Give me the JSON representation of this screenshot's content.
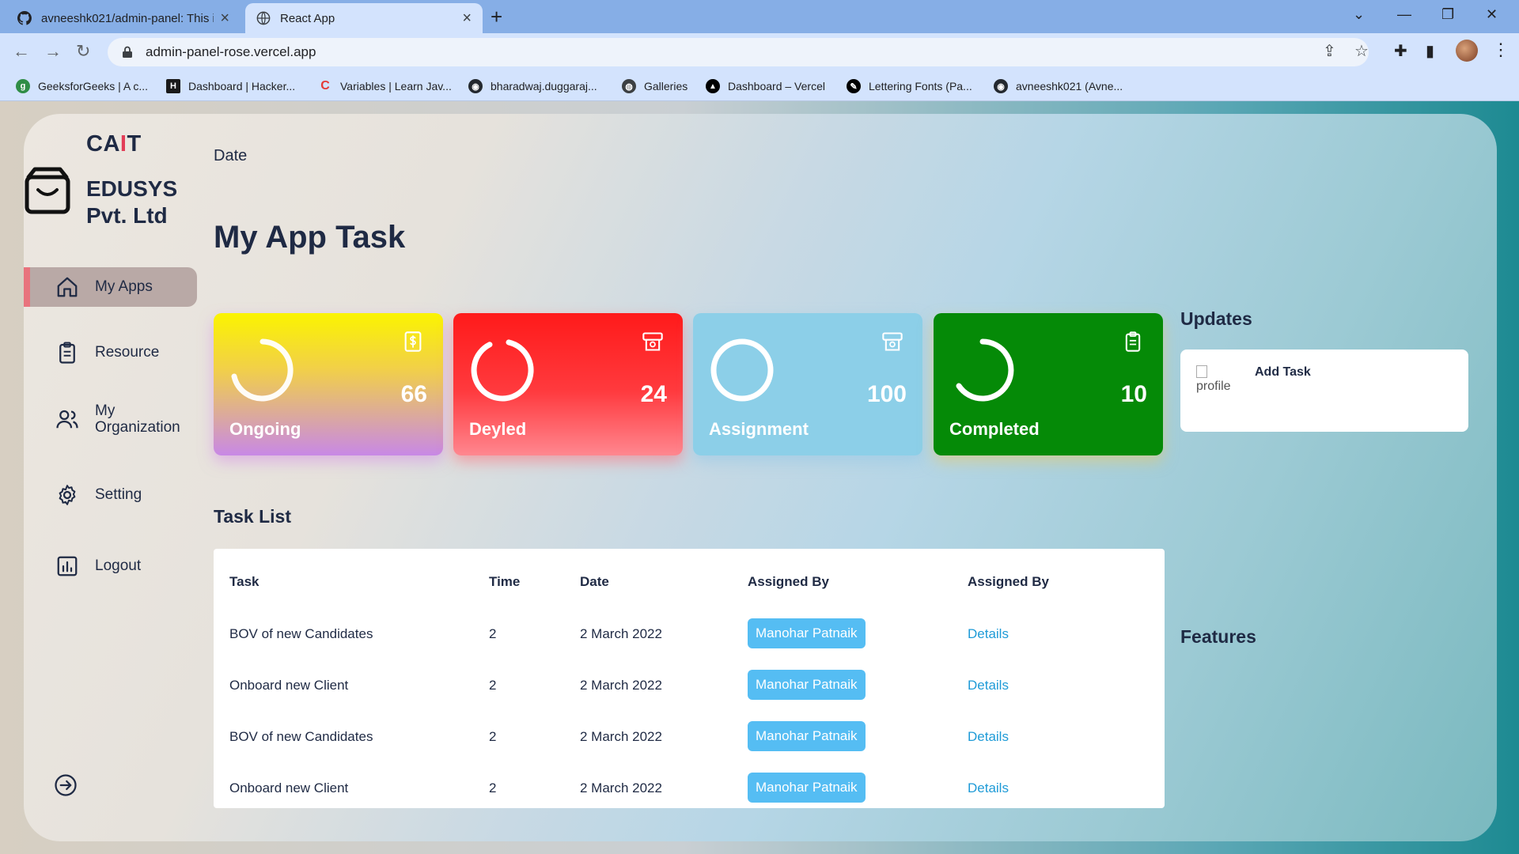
{
  "browser": {
    "tabs": [
      {
        "title": "avneeshk021/admin-panel: This i",
        "icon": "github-icon"
      },
      {
        "title": "React App",
        "icon": "globe-icon"
      }
    ],
    "url": "admin-panel-rose.vercel.app",
    "bookmarks": [
      {
        "label": "GeeksforGeeks | A c...",
        "icon": "gfg-icon",
        "color": "#2f8d46"
      },
      {
        "label": "Dashboard | Hacker...",
        "icon": "hackerrank-icon",
        "color": "#1a1a1a"
      },
      {
        "label": "Variables | Learn Jav...",
        "icon": "codecademy-icon",
        "color": "#e53935"
      },
      {
        "label": "bharadwaj.duggaraj...",
        "icon": "github-icon",
        "color": "#24292f"
      },
      {
        "label": "Galleries",
        "icon": "globe-icon",
        "color": "#3c4043"
      },
      {
        "label": "Dashboard – Vercel",
        "icon": "vercel-icon",
        "color": "#000000"
      },
      {
        "label": "Lettering Fonts (Pa...",
        "icon": "font-site-icon",
        "color": "#000000"
      },
      {
        "label": "avneeshk021 (Avne...",
        "icon": "github-icon",
        "color": "#24292f"
      }
    ]
  },
  "brand": {
    "title_part1": "CA",
    "title_accent": "I",
    "title_part2": "T",
    "name": "EDUSYS Pvt. Ltd"
  },
  "sidebar": {
    "items": [
      {
        "label": "My Apps",
        "icon": "home-icon",
        "active": true
      },
      {
        "label": "Resource",
        "icon": "clipboard-icon"
      },
      {
        "label": "My Organization",
        "icon": "users-icon"
      },
      {
        "label": "Setting",
        "icon": "gear-icon"
      },
      {
        "label": "Logout",
        "icon": "chart-icon"
      }
    ]
  },
  "main": {
    "date_label": "Date",
    "title": "My App Task",
    "cards": [
      {
        "label": "Ongoing",
        "count": "66",
        "icon": "dollar-file-icon"
      },
      {
        "label": "Deyled",
        "count": "24",
        "icon": "receipt-icon"
      },
      {
        "label": "Assignment",
        "count": "100",
        "icon": "receipt-icon"
      },
      {
        "label": "Completed",
        "count": "10",
        "icon": "clipboard-icon"
      }
    ],
    "task_list_title": "Task List",
    "table": {
      "headers": [
        "Task",
        "Time",
        "Date",
        "Assigned By",
        "Assigned By"
      ],
      "rows": [
        {
          "task": "BOV of new Candidates",
          "time": "2",
          "date": "2 March 2022",
          "assigned": "Manohar Patnaik",
          "action": "Details"
        },
        {
          "task": "Onboard new Client",
          "time": "2",
          "date": "2 March 2022",
          "assigned": "Manohar Patnaik",
          "action": "Details"
        },
        {
          "task": "BOV of new Candidates",
          "time": "2",
          "date": "2 March 2022",
          "assigned": "Manohar Patnaik",
          "action": "Details"
        },
        {
          "task": "Onboard new Client",
          "time": "2",
          "date": "2 March 2022",
          "assigned": "Manohar Patnaik",
          "action": "Details"
        }
      ]
    }
  },
  "updates": {
    "title": "Updates",
    "image_alt": "profile",
    "item": "Add Task"
  },
  "features": {
    "title": "Features"
  },
  "colors": {
    "accent": "#e23d57",
    "pill": "#55bdf3",
    "link": "#1f9bd7",
    "text": "#1f2a44"
  }
}
